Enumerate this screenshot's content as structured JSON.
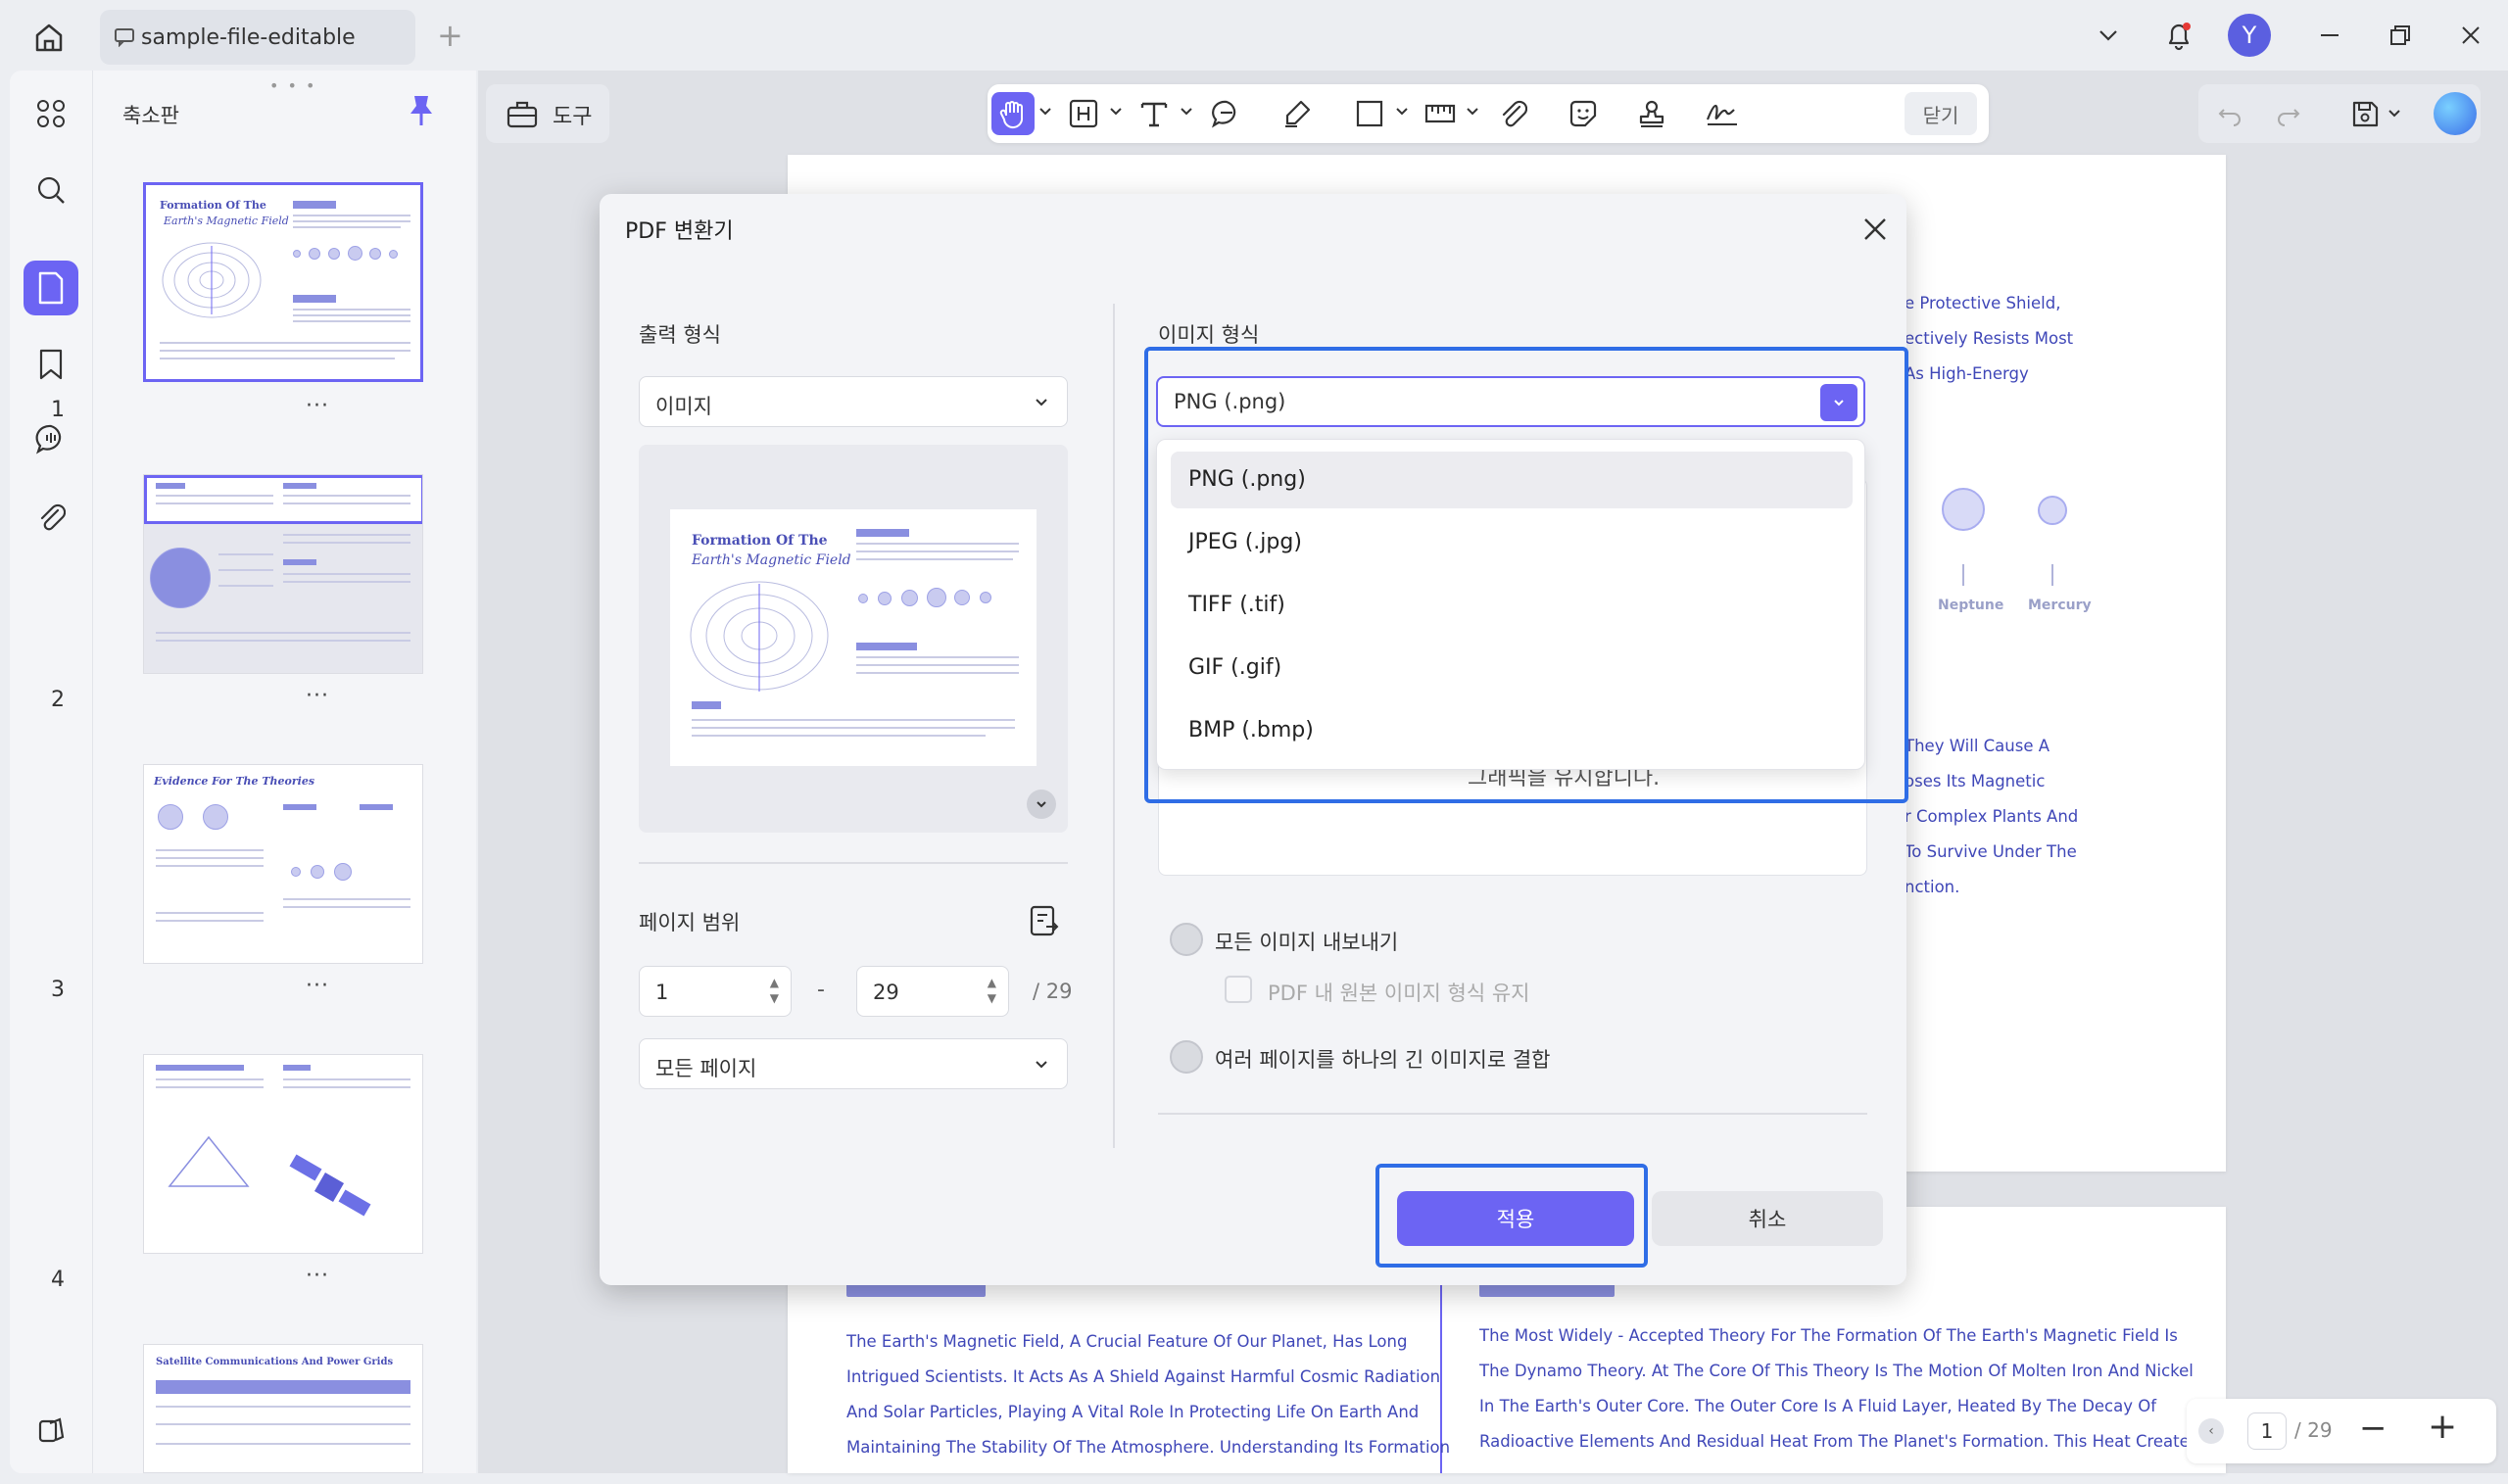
{
  "titlebar": {
    "tab_title": "sample-file-editable",
    "avatar_initial": "Y"
  },
  "sidebar": {
    "panel_title": "축소판",
    "thumbnails": [
      {
        "number": "1",
        "title_line1": "Formation Of The",
        "title_line2": "Earth's Magnetic Field"
      },
      {
        "number": "2"
      },
      {
        "number": "3",
        "title_line1": "Evidence For The Theories"
      },
      {
        "number": "4"
      },
      {
        "number": "",
        "title_line1": "Satellite Communications And Power Grids"
      }
    ]
  },
  "toolbar": {
    "tools_label": "도구",
    "close_label": "닫기"
  },
  "document": {
    "right_snippets_top": [
      "e Protective Shield,",
      "ectively Resists Most",
      "As High-Energy"
    ],
    "planets": [
      "Neptune",
      "Mercury"
    ],
    "right_snippets_mid": [
      "They Will Cause A",
      "oses Its Magnetic",
      "r Complex Plants And",
      "To Survive Under The",
      "nction."
    ],
    "left_paragraph": [
      "The Earth's Magnetic Field, A Crucial Feature Of Our Planet, Has Long",
      "Intrigued Scientists. It Acts As A Shield Against Harmful Cosmic Radiation",
      "And Solar Particles, Playing A Vital Role In Protecting Life On Earth And",
      "Maintaining The Stability Of The Atmosphere. Understanding Its Formation"
    ],
    "right_paragraph": [
      "The Most Widely - Accepted Theory For The Formation Of The Earth's Magnetic Field Is",
      "The Dynamo Theory. At The Core Of This Theory Is The Motion Of Molten Iron And Nickel",
      "In The Earth's Outer Core. The Outer Core Is A Fluid Layer, Heated By The Decay Of",
      "Radioactive Elements And Residual Heat From The Planet's Formation. This Heat Creates"
    ]
  },
  "pager": {
    "current_page": "1",
    "total_pages": "/ 29"
  },
  "dialog": {
    "title": "PDF 변환기",
    "output_format_label": "출력 형식",
    "output_format_value": "이미지",
    "preview_title_line1": "Formation Of The",
    "preview_title_line2": "Earth's Magnetic Field",
    "page_range_label": "페이지 범위",
    "range_from": "1",
    "range_dash": "-",
    "range_to": "29",
    "range_total": "/ 29",
    "page_subset_value": "모든 페이지",
    "image_format_label": "이미지 형식",
    "image_format_value": "PNG (.png)",
    "image_format_options": [
      "PNG (.png)",
      "JPEG (.jpg)",
      "TIFF (.tif)",
      "GIF (.gif)",
      "BMP (.bmp)"
    ],
    "obscured_text": "그래픽을 유지합니다.",
    "export_all_images_label": "모든 이미지 내보내기",
    "keep_original_format_label": "PDF 내 원본 이미지 형식 유지",
    "combine_pages_label": "여러 페이지를 하나의 긴 이미지로 결합",
    "apply_label": "적용",
    "cancel_label": "취소"
  },
  "colors": {
    "accent": "#6c64f3",
    "highlight_frame": "#2f6de6",
    "doc_text": "#3f47b8"
  }
}
